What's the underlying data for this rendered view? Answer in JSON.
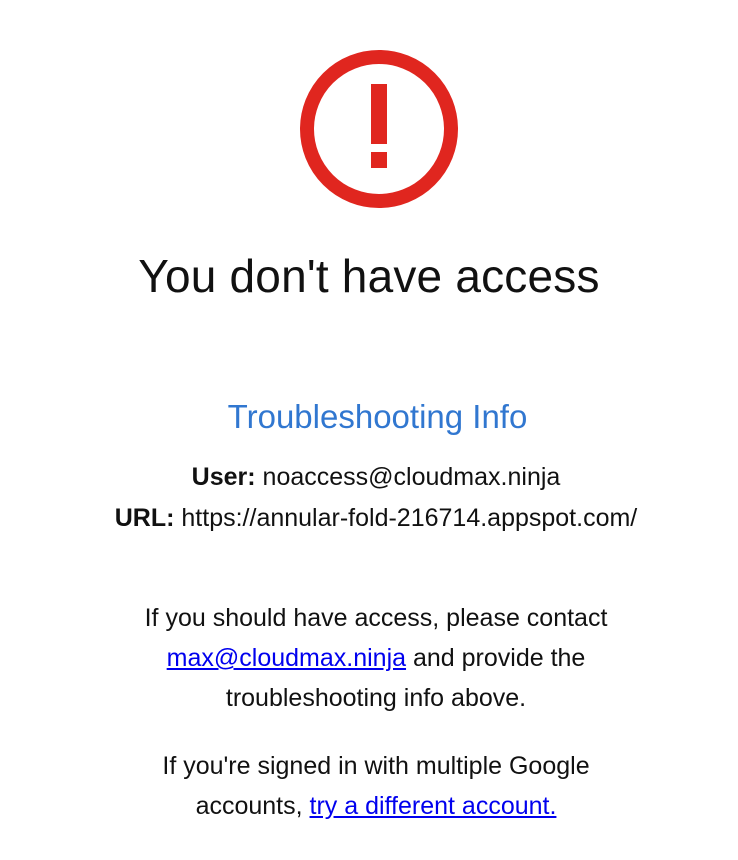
{
  "colors": {
    "error_red": "#e0261f",
    "heading_blue": "#3177d0",
    "link_blue": "#0000ee",
    "text": "#111111",
    "background": "#ffffff"
  },
  "icon": {
    "name": "error-exclamation-icon"
  },
  "title": "You don't have access",
  "troubleshooting": {
    "heading": "Troubleshooting Info",
    "user_label": "User:",
    "user_value": "noaccess@cloudmax.ninja",
    "url_label": "URL:",
    "url_value": "https://annular-fold-216714.appspot.com/"
  },
  "contact": {
    "line1": "If you should have access, please contact",
    "email_link": "max@cloudmax.ninja",
    "line2_after": "and provide the",
    "line3": "troubleshooting info above."
  },
  "switch_account": {
    "line1": "If you're signed in with multiple Google",
    "line2_before": "accounts,",
    "link": "try a different account."
  }
}
